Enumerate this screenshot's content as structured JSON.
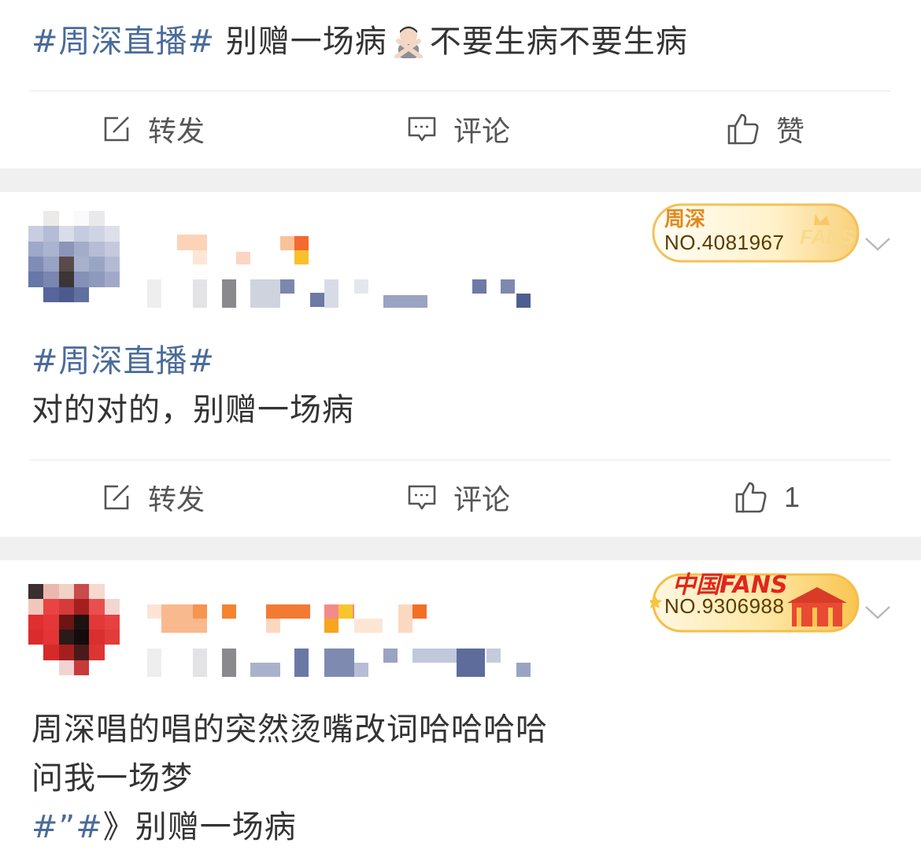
{
  "top_post": {
    "hashtag": "#周深直播#",
    "text_before_emoji": " 别赠一场病",
    "emoji": "person-gesturing-no-emoji",
    "text_after_emoji": "不要生病不要生病",
    "actions": {
      "repost": "转发",
      "comment": "评论",
      "like": "赞"
    }
  },
  "comments": [
    {
      "badge": {
        "title": "周深",
        "number": "NO.4081967",
        "watermark": "FANS"
      },
      "hashtag": "#周深直播#",
      "lines": [
        "对的对的，别赠一场病"
      ],
      "actions": {
        "repost": "转发",
        "comment": "评论",
        "like_count": "1"
      }
    },
    {
      "badge": {
        "title": "中国FANS",
        "number": "NO.9306988"
      },
      "lines": [
        "周深唱的唱的突然烫嘴改词哈哈哈哈",
        "问我一场梦"
      ],
      "last_line": {
        "hashtag": "#”#",
        "text": "》别赠一场病"
      }
    }
  ],
  "colors": {
    "accent": "#4a6b9a",
    "text": "#333333",
    "separator": "#f0f0f0",
    "badge_gold": "#f7c35a"
  }
}
